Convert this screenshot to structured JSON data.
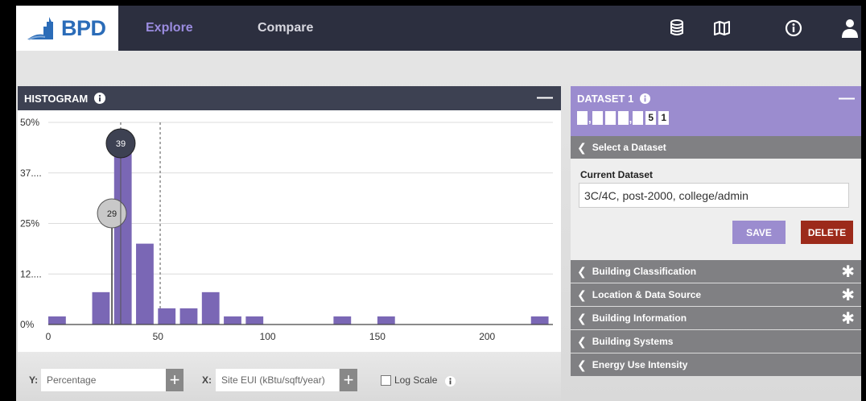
{
  "nav": {
    "logo_text": "BPD",
    "links": [
      "Explore",
      "Compare"
    ],
    "icons": [
      "database-icon",
      "map-icon",
      "info-icon",
      "user-icon"
    ]
  },
  "histogram": {
    "title": "HISTOGRAM",
    "collapse_label": "—",
    "y_control": {
      "label": "Y:",
      "value": "Percentage"
    },
    "x_control": {
      "label": "X:",
      "value": "Site EUI (kBtu/sqft/year)"
    },
    "log_scale_label": "Log Scale"
  },
  "chart_data": {
    "type": "bar",
    "xlim": [
      0,
      230
    ],
    "ylim": [
      0,
      50
    ],
    "bin_width": 8,
    "bins": [
      {
        "x": 0,
        "value": 2
      },
      {
        "x": 20,
        "value": 8
      },
      {
        "x": 30,
        "value": 43
      },
      {
        "x": 40,
        "value": 20
      },
      {
        "x": 50,
        "value": 4
      },
      {
        "x": 60,
        "value": 4
      },
      {
        "x": 70,
        "value": 8
      },
      {
        "x": 80,
        "value": 2
      },
      {
        "x": 90,
        "value": 2
      },
      {
        "x": 130,
        "value": 2
      },
      {
        "x": 150,
        "value": 2
      },
      {
        "x": 220,
        "value": 2
      }
    ],
    "y_ticks": [
      "0%",
      "12....",
      "25%",
      "37....",
      "50%"
    ],
    "y_tick_values": [
      0,
      12.5,
      25,
      37.5,
      50
    ],
    "x_ticks": [
      "0",
      "50",
      "100",
      "150",
      "200"
    ],
    "x_tick_values": [
      0,
      50,
      100,
      150,
      200
    ],
    "markers": [
      {
        "label": "29",
        "x": 29,
        "style": "light"
      },
      {
        "label": "39",
        "x": 33,
        "style": "dark"
      }
    ],
    "dashed_lines_x": [
      33,
      51
    ]
  },
  "dataset": {
    "title": "DATASET 1",
    "collapse_label": "—",
    "count_digits": [
      "",
      "",
      "",
      "",
      "",
      "5",
      "1"
    ],
    "select_label": "Select a Dataset",
    "current_label": "Current Dataset",
    "current_value": "3C/4C, post-2000, college/admin",
    "save_label": "SAVE",
    "delete_label": "DELETE",
    "sections": [
      {
        "label": "Building Classification",
        "star": true
      },
      {
        "label": "Location & Data Source",
        "star": true
      },
      {
        "label": "Building Information",
        "star": true
      },
      {
        "label": "Building Systems",
        "star": false
      },
      {
        "label": "Energy Use Intensity",
        "star": false
      }
    ]
  },
  "colors": {
    "nav_bg": "#2c2f3f",
    "accent": "#9b8ccf",
    "bar": "#7a67b5",
    "delete": "#9c2a1a"
  }
}
